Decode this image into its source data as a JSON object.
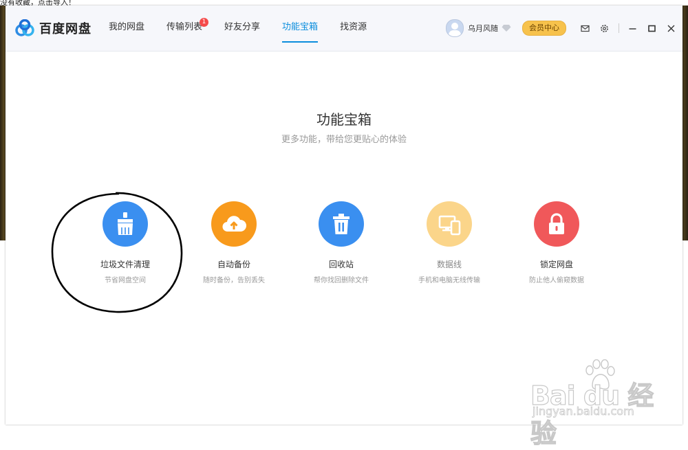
{
  "top_strip_text": "没有收藏，点击导入！",
  "app": {
    "name": "百度网盘"
  },
  "nav": [
    {
      "label": "我的网盘"
    },
    {
      "label": "传输列表",
      "badge": "1"
    },
    {
      "label": "好友分享"
    },
    {
      "label": "功能宝箱",
      "active": true
    },
    {
      "label": "找资源"
    }
  ],
  "user": {
    "name": "乌月风随",
    "vip_button": "会员中心"
  },
  "page": {
    "title": "功能宝箱",
    "subtitle": "更多功能，带给您更贴心的体验"
  },
  "tools": [
    {
      "name": "垃圾文件清理",
      "desc": "节省网盘空间",
      "icon": "broom-icon",
      "color": "#3a8ff0"
    },
    {
      "name": "自动备份",
      "desc": "随时备份，告别丢失",
      "icon": "cloud-upload-icon",
      "color": "#f89a1c"
    },
    {
      "name": "回收站",
      "desc": "帮你找回删除文件",
      "icon": "trash-icon",
      "color": "#3a8ff0"
    },
    {
      "name": "数据线",
      "desc": "手机和电脑无线传输",
      "icon": "devices-icon",
      "color": "#fbd58a"
    },
    {
      "name": "锁定网盘",
      "desc": "防止他人偷窥数据",
      "icon": "lock-icon",
      "color": "#f0585a"
    }
  ],
  "watermark": {
    "brand": "Bai du 经验",
    "url": "jingyan.baidu.com"
  },
  "colors": {
    "accent": "#0a8ddd",
    "vip": "#f7c24c",
    "badge": "#f54b4b"
  }
}
